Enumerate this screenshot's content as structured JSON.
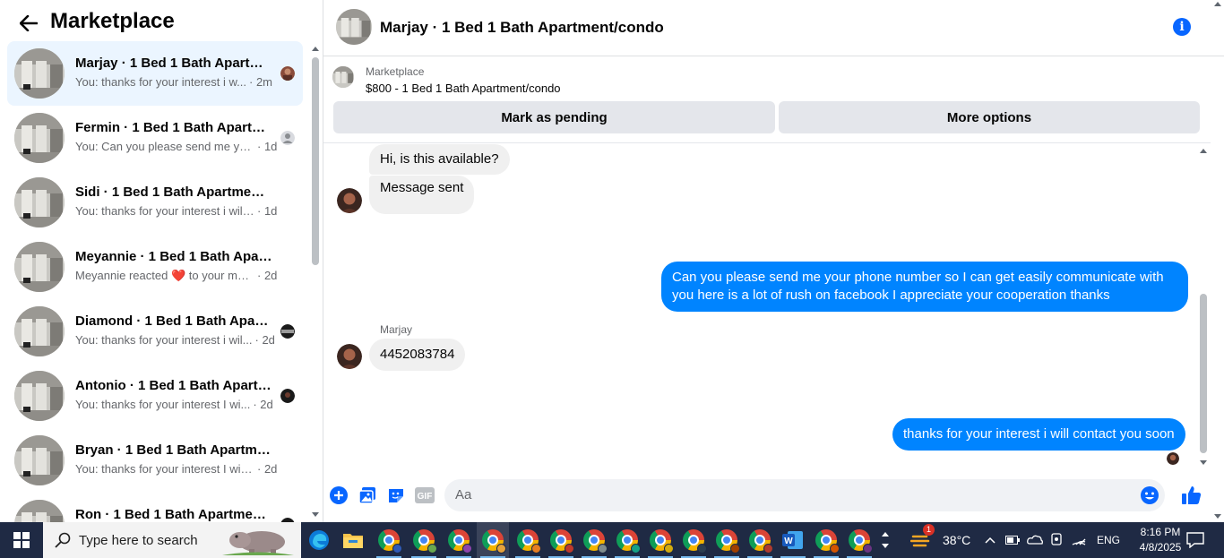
{
  "left": {
    "title": "Marketplace",
    "conversations": [
      {
        "name": "Marjay · 1 Bed 1 Bath Apartme...",
        "snippet": "You: thanks for your interest i w...",
        "time": "· 2m",
        "active": true,
        "seen": "avatar-photo"
      },
      {
        "name": "Fermin · 1 Bed 1 Bath Apartme...",
        "snippet": "You: Can you please send me yo...",
        "time": "· 1d",
        "active": false,
        "seen": "default-avatar"
      },
      {
        "name": "Sidi · 1 Bed 1 Bath Apartment/co...",
        "snippet": "You: thanks for your interest i will c...",
        "time": "· 1d",
        "active": false,
        "seen": ""
      },
      {
        "name": "Meyannie · 1 Bed 1 Bath Apartm...",
        "snippet": "Meyannie reacted ❤️ to your mess...",
        "time": "· 2d",
        "active": false,
        "seen": ""
      },
      {
        "name": "Diamond · 1 Bed 1 Bath Apart...",
        "snippet": "You: thanks for your interest i wil...",
        "time": "· 2d",
        "active": false,
        "seen": "dark-avatar"
      },
      {
        "name": "Antonio · 1 Bed 1 Bath Apartm...",
        "snippet": "You: thanks for your interest I wi...",
        "time": "· 2d",
        "active": false,
        "seen": "dark-avatar"
      },
      {
        "name": "Bryan · 1 Bed 1 Bath Apartment/...",
        "snippet": "You: thanks for your interest I will c...",
        "time": "· 2d",
        "active": false,
        "seen": ""
      },
      {
        "name": "Ron · 1 Bed 1 Bath Apartment/...",
        "snippet": "",
        "time": "",
        "active": false,
        "seen": "dark-avatar"
      }
    ]
  },
  "chat": {
    "title": "Marjay · 1 Bed 1 Bath Apartment/condo",
    "listing_source": "Marketplace",
    "listing_title": "$800 - 1 Bed 1 Bath Apartment/condo",
    "btn_pending": "Mark as pending",
    "btn_more": "More options",
    "messages": {
      "m1": "Hi, is this available?",
      "m2": "Message sent",
      "m3": "Can you please send me your phone number so I can get easily communicate with you here is a lot of rush on facebook I appreciate your cooperation thanks",
      "sender": "Marjay",
      "m4": "4452083784",
      "m5": "thanks for your interest i will contact you soon"
    },
    "composer_placeholder": "Aa"
  },
  "taskbar": {
    "search_placeholder": "Type here to search",
    "weather": "38°C",
    "weather_badge": "1",
    "language": "ENG",
    "time": "8:16 PM",
    "date": "4/8/2025"
  },
  "colors": {
    "accent": "#0866ff",
    "outgoing_bubble": "#0084ff",
    "incoming_bubble": "#f0f0f0",
    "active_row": "#ebf5ff",
    "taskbar": "#1f2a44"
  }
}
